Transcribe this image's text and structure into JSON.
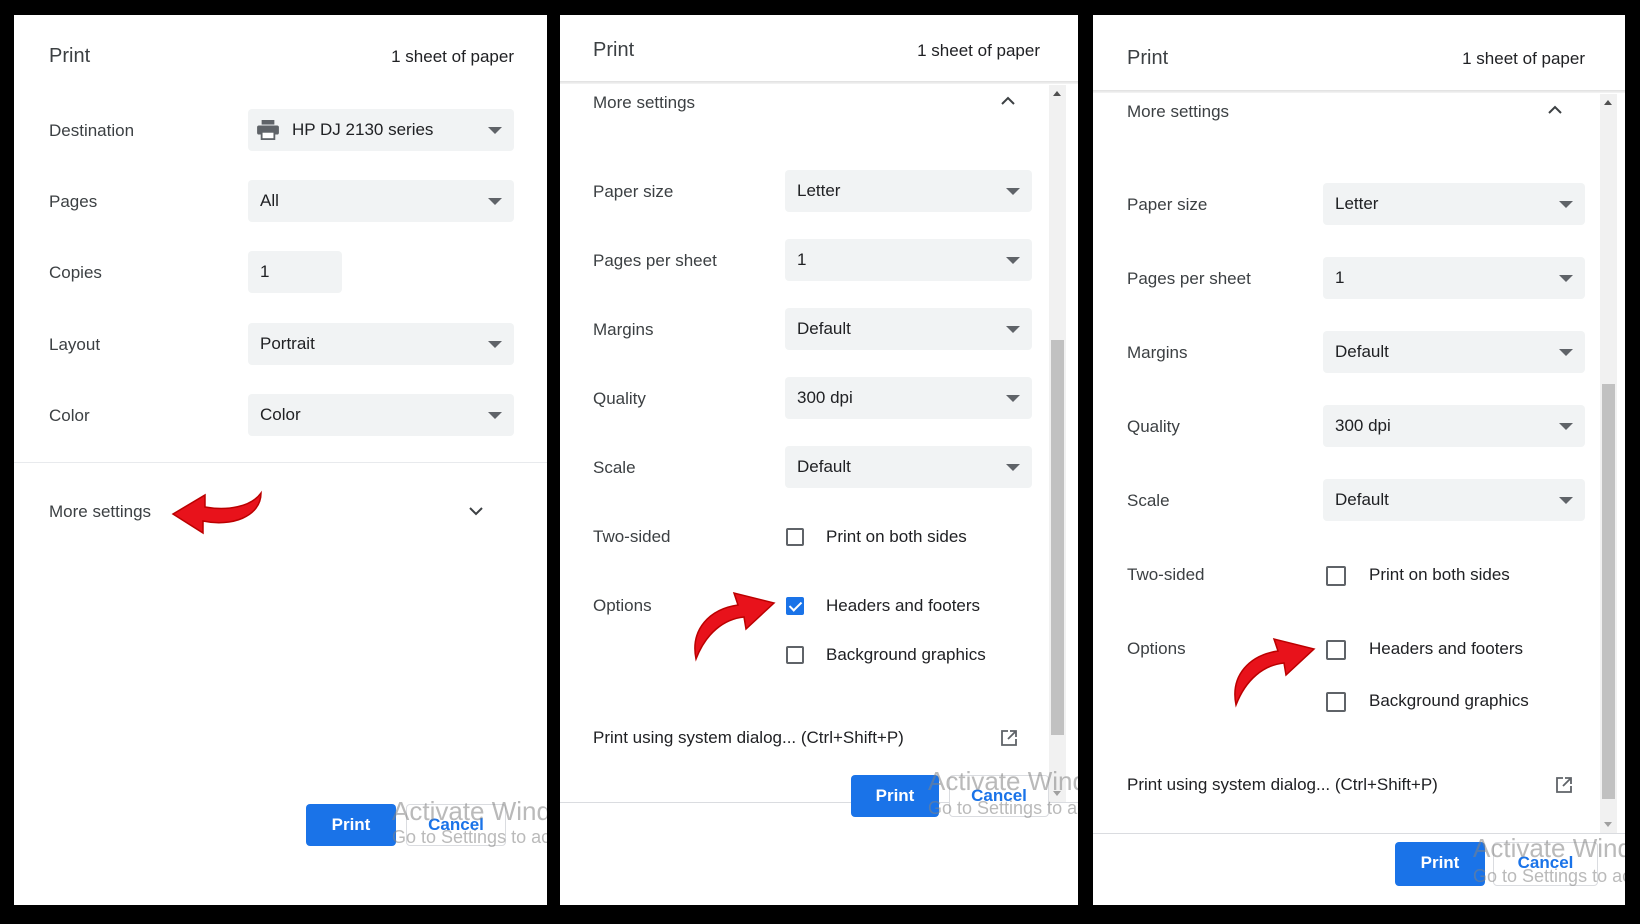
{
  "panels": [
    {
      "title": "Print",
      "sheets": "1 sheet of paper",
      "destination": {
        "label": "Destination",
        "value": "HP DJ 2130 series",
        "icon": "printer-icon"
      },
      "pages": {
        "label": "Pages",
        "value": "All"
      },
      "copies": {
        "label": "Copies",
        "value": "1"
      },
      "layout": {
        "label": "Layout",
        "value": "Portrait"
      },
      "color": {
        "label": "Color",
        "value": "Color"
      },
      "more_settings": {
        "label": "More settings",
        "icon": "chevron-down-icon"
      },
      "print_button": "Print",
      "cancel_button": "Cancel"
    },
    {
      "title": "Print",
      "sheets": "1 sheet of paper",
      "more_settings": {
        "label": "More settings",
        "icon": "chevron-up-icon"
      },
      "paper_size": {
        "label": "Paper size",
        "value": "Letter"
      },
      "pages_per_sheet": {
        "label": "Pages per sheet",
        "value": "1"
      },
      "margins": {
        "label": "Margins",
        "value": "Default"
      },
      "quality": {
        "label": "Quality",
        "value": "300 dpi"
      },
      "scale": {
        "label": "Scale",
        "value": "Default"
      },
      "two_sided": {
        "label": "Two-sided",
        "option": "Print on both sides",
        "checked": false
      },
      "options": {
        "label": "Options",
        "items": [
          {
            "label": "Headers and footers",
            "checked": true
          },
          {
            "label": "Background graphics",
            "checked": false
          }
        ]
      },
      "system_dialog": {
        "label": "Print using system dialog... (Ctrl+Shift+P)",
        "icon": "open-external-icon"
      },
      "print_button": "Print",
      "cancel_button": "Cancel"
    },
    {
      "title": "Print",
      "sheets": "1 sheet of paper",
      "more_settings": {
        "label": "More settings",
        "icon": "chevron-up-icon"
      },
      "paper_size": {
        "label": "Paper size",
        "value": "Letter"
      },
      "pages_per_sheet": {
        "label": "Pages per sheet",
        "value": "1"
      },
      "margins": {
        "label": "Margins",
        "value": "Default"
      },
      "quality": {
        "label": "Quality",
        "value": "300 dpi"
      },
      "scale": {
        "label": "Scale",
        "value": "Default"
      },
      "two_sided": {
        "label": "Two-sided",
        "option": "Print on both sides",
        "checked": false
      },
      "options": {
        "label": "Options",
        "items": [
          {
            "label": "Headers and footers",
            "checked": false
          },
          {
            "label": "Background graphics",
            "checked": false
          }
        ]
      },
      "system_dialog": {
        "label": "Print using system dialog... (Ctrl+Shift+P)",
        "icon": "open-external-icon"
      },
      "print_button": "Print",
      "cancel_button": "Cancel"
    }
  ],
  "watermark": {
    "line1": "Activate Windows",
    "line2": "Go to Settings to activate Windows."
  },
  "colors": {
    "accent": "#1a73e8",
    "annotation_arrow": "#e8121b",
    "field_bg": "#f1f3f4"
  }
}
